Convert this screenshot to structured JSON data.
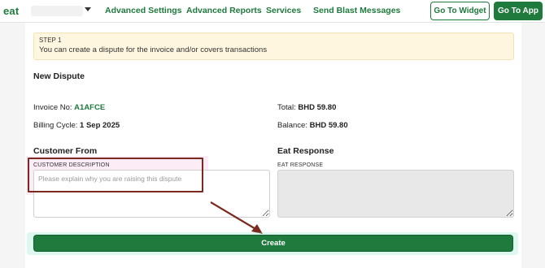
{
  "nav": {
    "brand": "eat",
    "links": [
      "Advanced Settings",
      "Advanced Reports",
      "Services",
      "Send Blast Messages"
    ],
    "go_to_widget": "Go To Widget",
    "go_to_app": "Go To App"
  },
  "step": {
    "number": "STEP 1",
    "text": "You can create a dispute for the invoice and/or covers transactions"
  },
  "dispute": {
    "title": "New Dispute",
    "invoice_label": "Invoice No:",
    "invoice_value": "A1AFCE",
    "billing_label": "Billing Cycle:",
    "billing_value": "1 Sep 2025",
    "total_label": "Total:",
    "total_value": "BHD 59.80",
    "balance_label": "Balance:",
    "balance_value": "BHD 59.80"
  },
  "customer": {
    "section_title": "Customer From",
    "field_label": "CUSTOMER DESCRIPTION",
    "placeholder": "Please explain why you are raising this dispute",
    "value": ""
  },
  "eat_response": {
    "section_title": "Eat Response",
    "field_label": "EAT RESPONSE",
    "value": ""
  },
  "actions": {
    "create": "Create"
  },
  "colors": {
    "brand_green": "#1f7a3d",
    "step_bg": "#fff6df",
    "highlight_border": "#7a2a1e"
  }
}
